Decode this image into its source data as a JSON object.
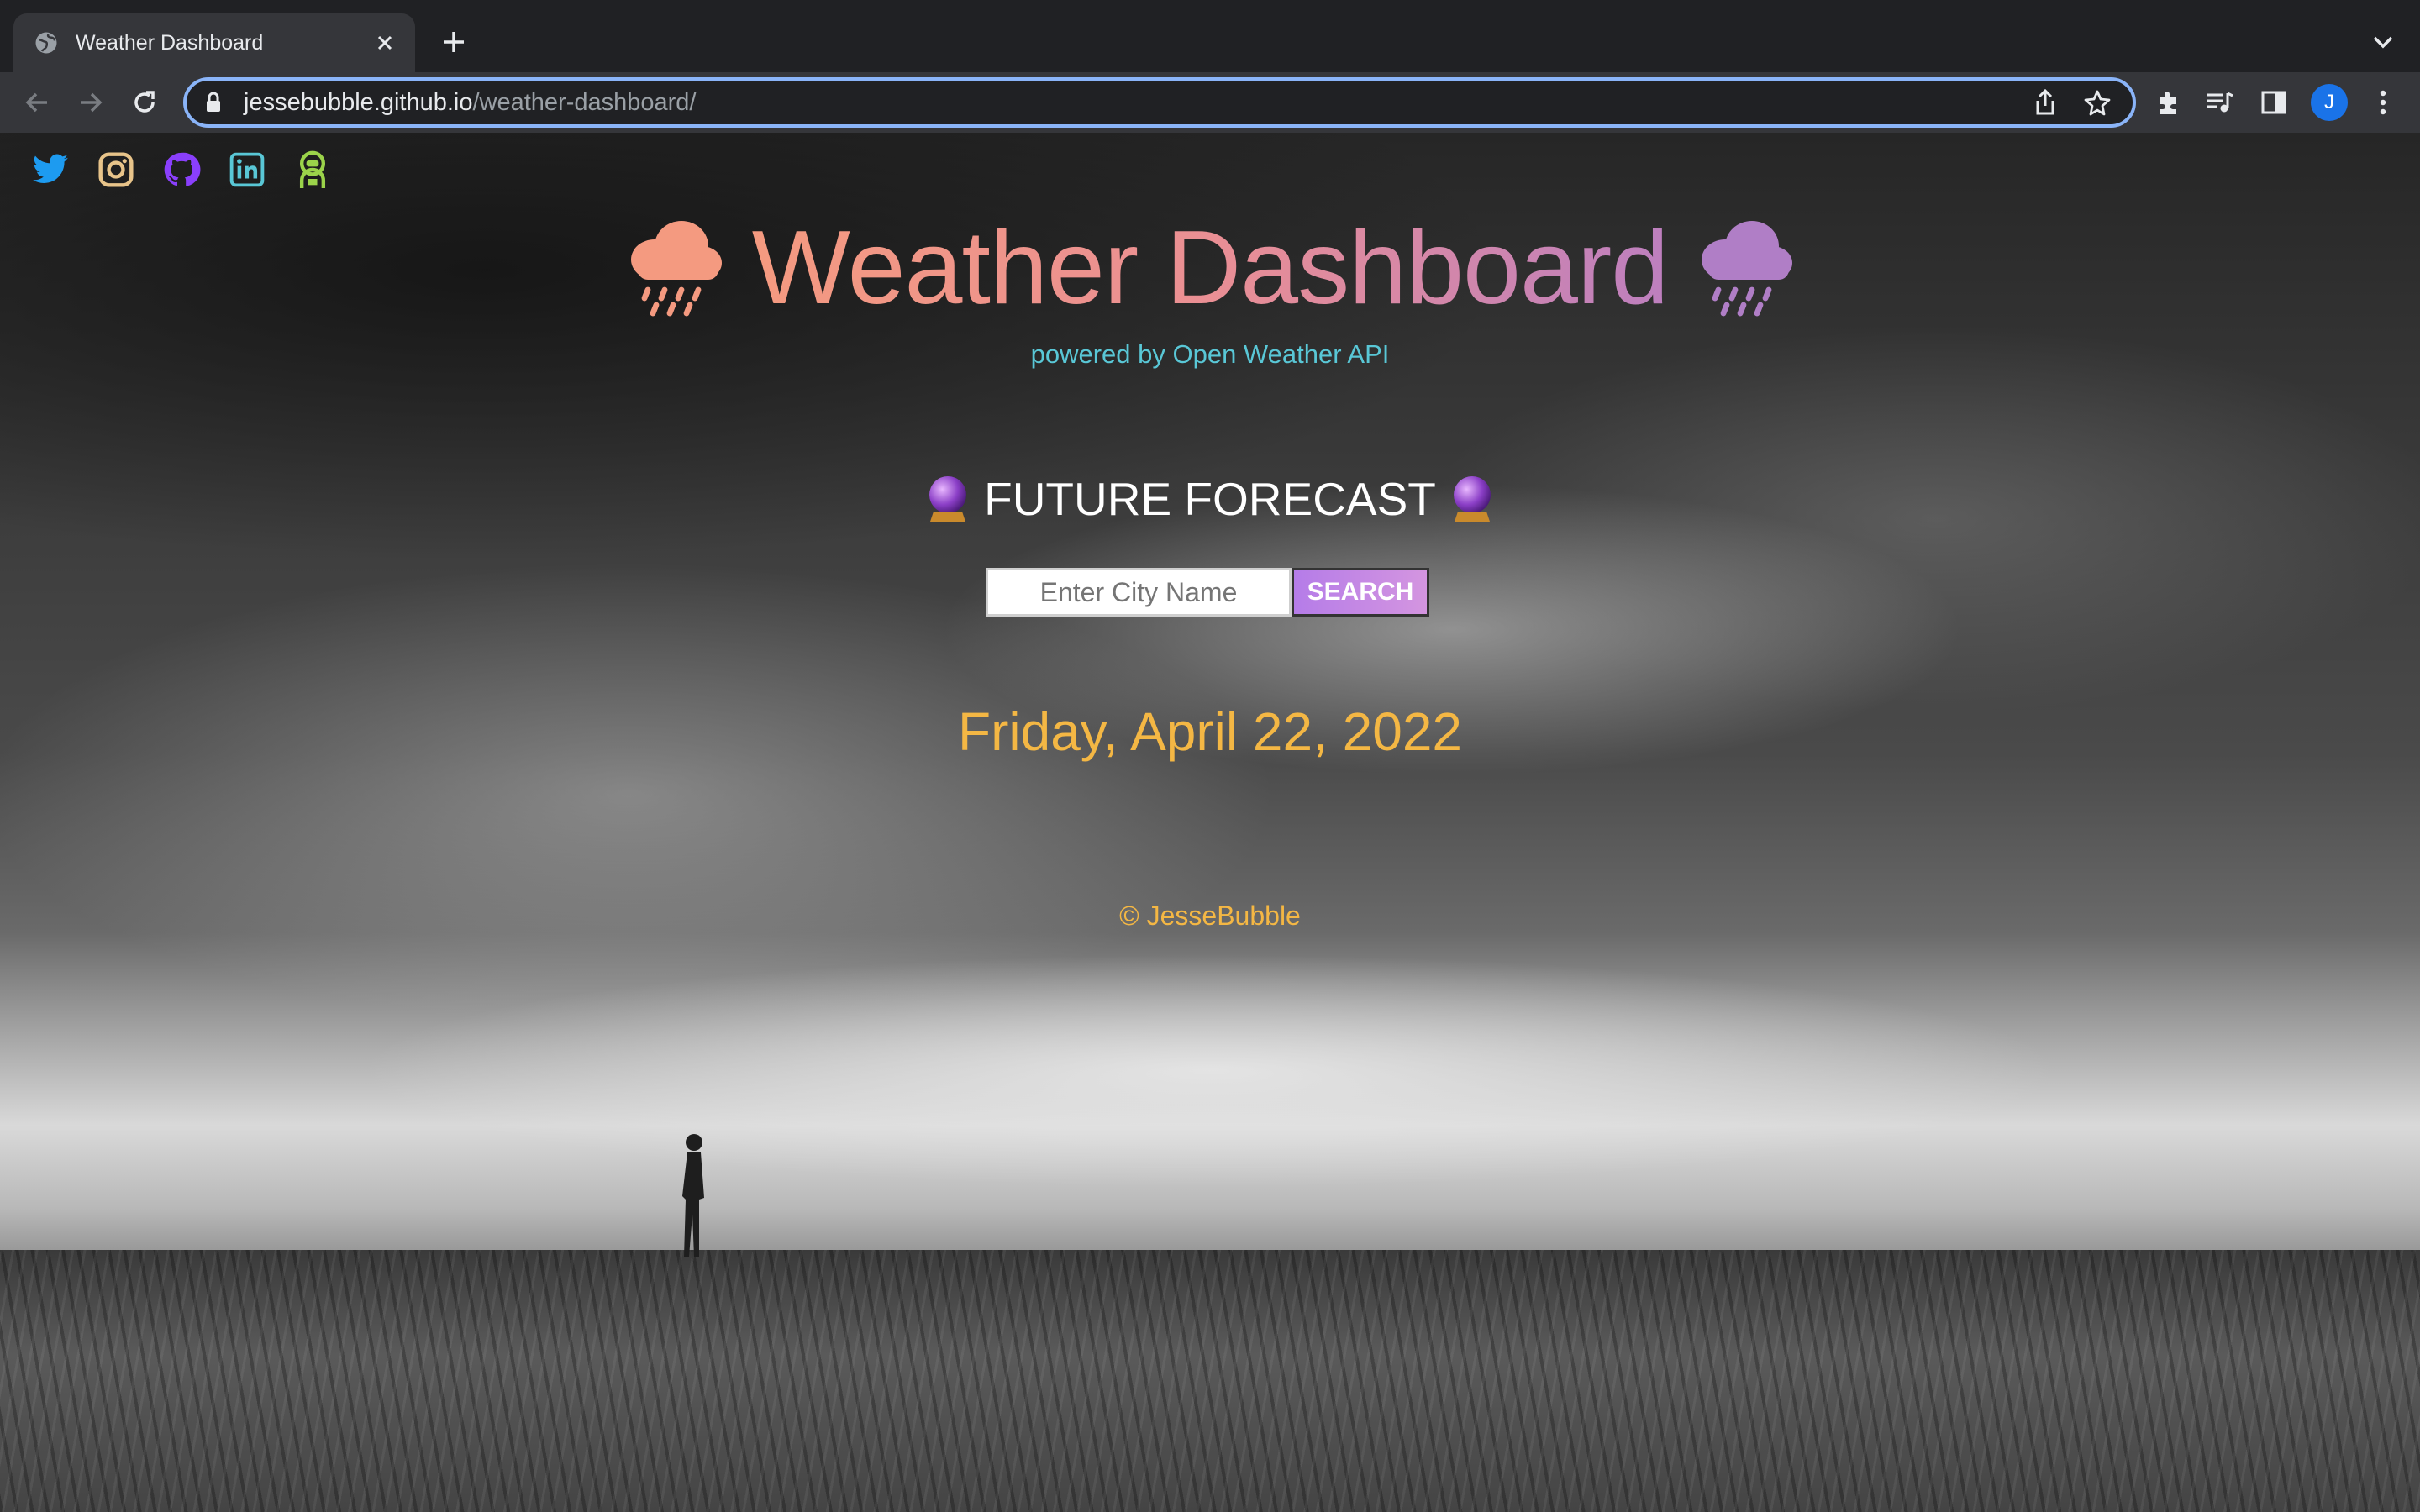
{
  "browser": {
    "tab_title": "Weather Dashboard",
    "url_host": "jessebubble.github.io",
    "url_path": "/weather-dashboard/",
    "profile_initial": "J",
    "accent_color": "#8ab4f8"
  },
  "page": {
    "social_links": [
      {
        "name": "twitter-icon",
        "color": "#1d9bf0"
      },
      {
        "name": "instagram-icon",
        "color": "#e8c48a"
      },
      {
        "name": "github-icon",
        "color": "#8a3ffc"
      },
      {
        "name": "linkedin-icon",
        "color": "#59c7d6"
      },
      {
        "name": "portfolio-icon",
        "color": "#9bd34a"
      }
    ],
    "title": "Weather Dashboard",
    "title_emoji_left": "🌧",
    "title_emoji_right": "🌧",
    "subtitle": "powered by Open Weather API",
    "forecast_emoji": "🔮",
    "forecast_label": "FUTURE FORECAST",
    "search_placeholder": "Enter City Name",
    "search_button": "SEARCH",
    "date": "Friday, April 22, 2022",
    "footer": "© JesseBubble",
    "colors": {
      "title_gradient_start": "#f49a80",
      "title_gradient_end": "#bd7fbf",
      "subtitle": "#59c7d6",
      "date": "#f4b744",
      "search_button": "#b57ce8"
    }
  }
}
